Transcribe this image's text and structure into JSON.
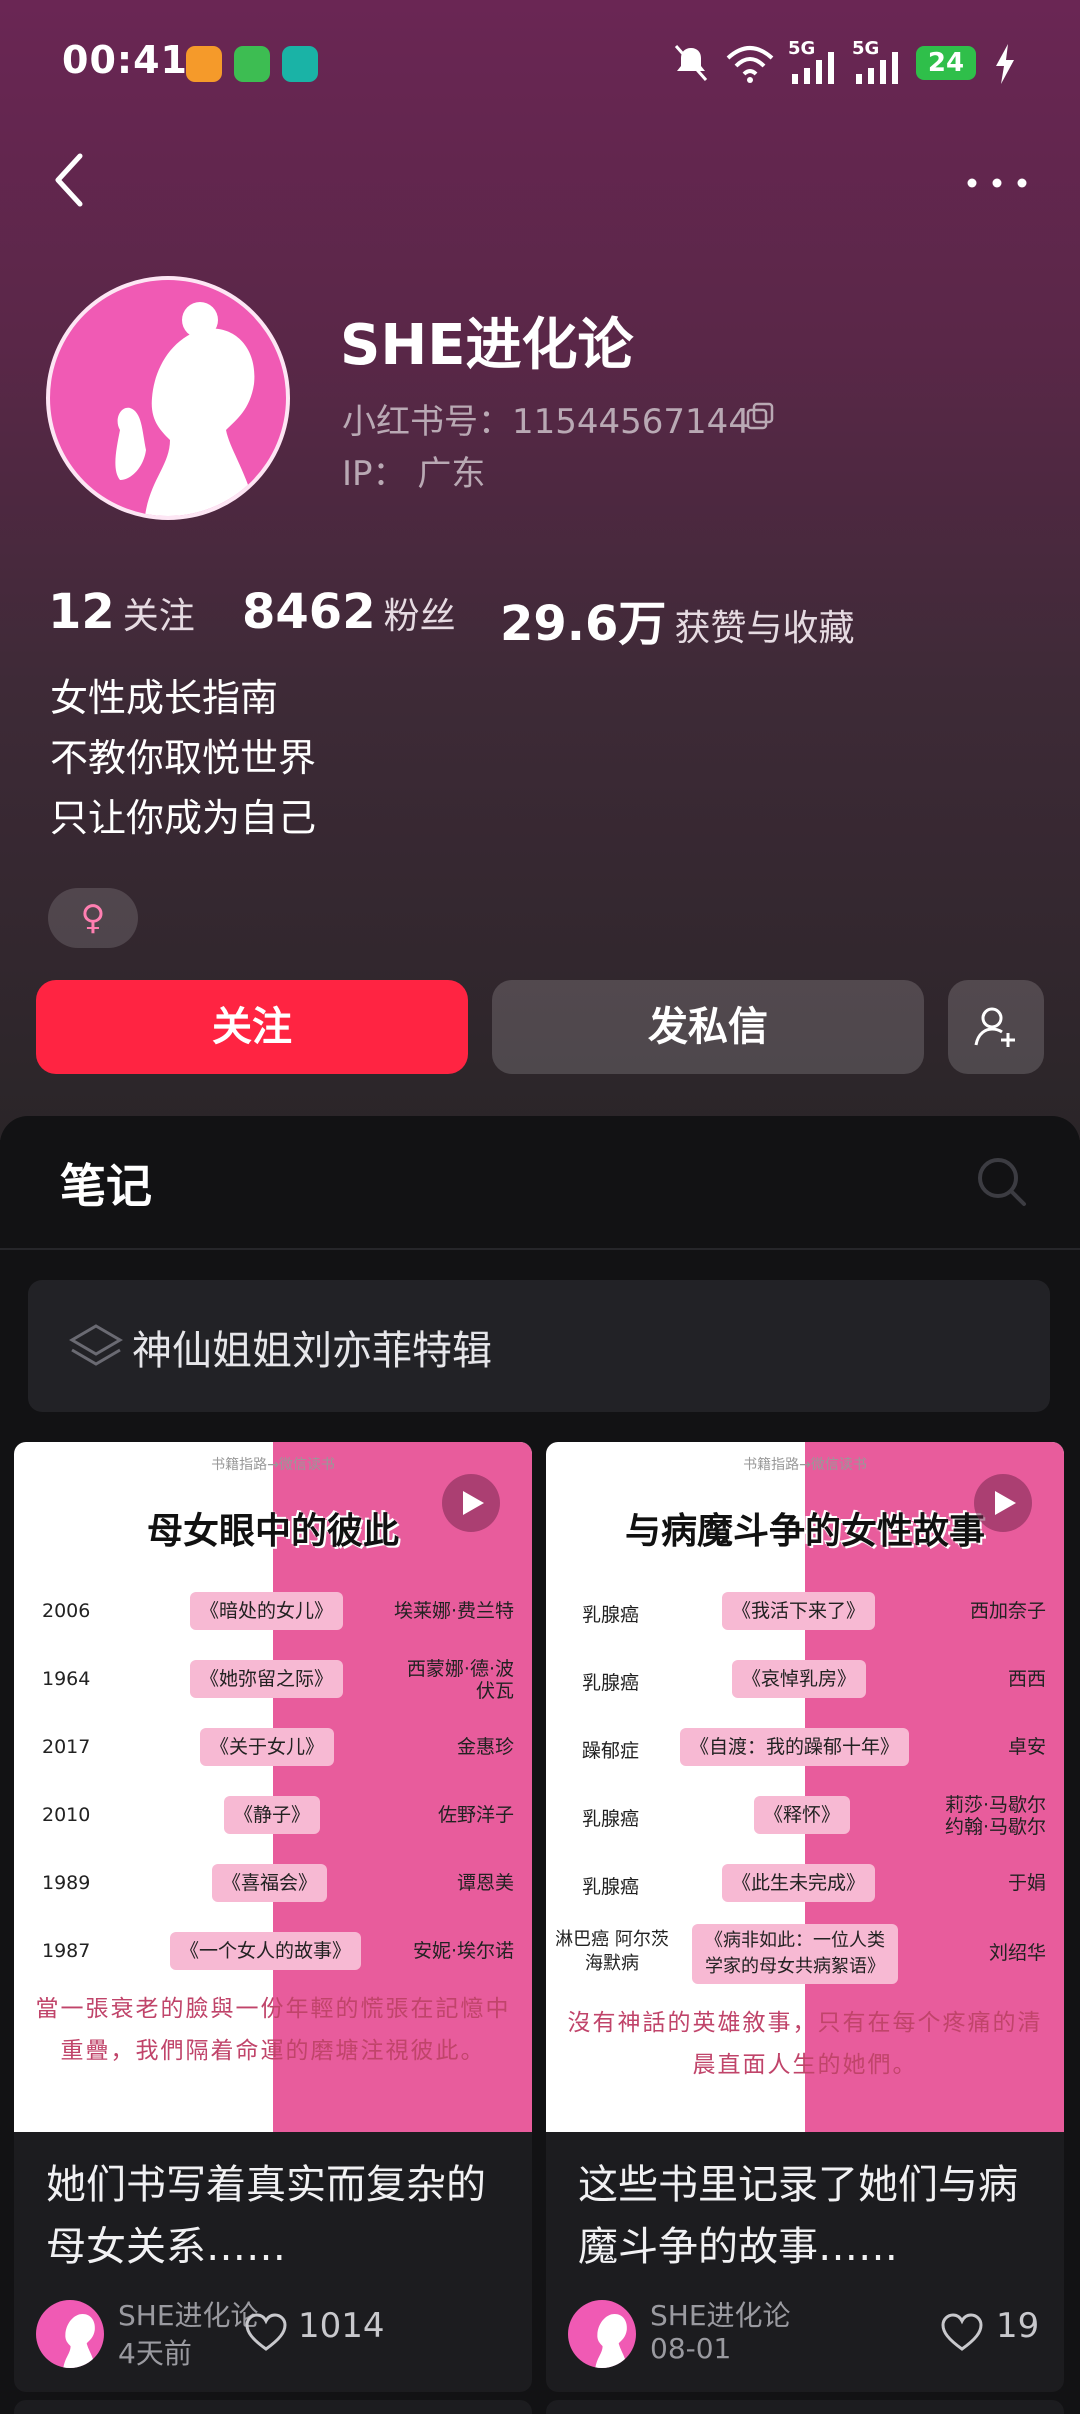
{
  "status_bar": {
    "time": "00:41",
    "battery": "24",
    "network_1": "5G",
    "network_2": "5G",
    "icons": [
      "mute-icon",
      "wifi-icon",
      "signal-icon",
      "charging-icon"
    ]
  },
  "colors": {
    "accent": "#ff2442",
    "avatar_pink": "#f05ab4",
    "hero_top": "#6a2654"
  },
  "profile": {
    "name": "SHE进化论",
    "red_id": "小红书号：11544567144",
    "ip": "IP：  广东",
    "stats": [
      {
        "num": "12",
        "label": "关注"
      },
      {
        "num": "8462",
        "label": "粉丝"
      },
      {
        "num": "29.6万",
        "label": "获赞与收藏"
      }
    ],
    "bio": [
      "女性成长指南",
      "不教你取悦世界",
      "只让你成为自己"
    ],
    "gender_symbol": "♀"
  },
  "actions": {
    "follow": "关注",
    "message": "发私信"
  },
  "notes": {
    "tab_title": "笔记",
    "collection": "神仙姐姐刘亦菲特辑"
  },
  "cards": [
    {
      "cover_small": "书籍指路→微信读书",
      "cover_title": "母女眼中的彼此",
      "rows": [
        {
          "c1": "2006",
          "c2": "《暗处的女儿》",
          "c3": "埃莱娜·费兰特"
        },
        {
          "c1": "1964",
          "c2": "《她弥留之际》",
          "c3": "西蒙娜·德·波伏瓦"
        },
        {
          "c1": "2017",
          "c2": "《关于女儿》",
          "c3": "金惠珍"
        },
        {
          "c1": "2010",
          "c2": "《静子》",
          "c3": "佐野洋子"
        },
        {
          "c1": "1989",
          "c2": "《喜福会》",
          "c3": "谭恩美"
        },
        {
          "c1": "1987",
          "c2": "《一个女人的故事》",
          "c3": "安妮·埃尔诺"
        }
      ],
      "quote": "當一張衰老的臉與一份年輕的慌張在記憶中重疊，我們隔着命運的磨塘注視彼此。",
      "title": "她们书写着真实而复杂的母女关系……",
      "author": "SHE进化论",
      "date": "4天前",
      "likes": "1014"
    },
    {
      "cover_small": "书籍指路→微信读书",
      "cover_title": "与病魔斗争的女性故事",
      "rows": [
        {
          "c1": "乳腺癌",
          "c2": "《我活下来了》",
          "c3": "西加奈子"
        },
        {
          "c1": "乳腺癌",
          "c2": "《哀悼乳房》",
          "c3": "西西"
        },
        {
          "c1": "躁郁症",
          "c2": "《自渡：我的躁郁十年》",
          "c3": "卓安"
        },
        {
          "c1": "乳腺癌",
          "c2": "《释怀》",
          "c3": "莉莎·马歇尔 约翰·马歇尔"
        },
        {
          "c1": "乳腺癌",
          "c2": "《此生未完成》",
          "c3": "于娟"
        },
        {
          "c1": "淋巴癌 阿尔茨海默病",
          "c2": "《病非如此：一位人类学家的母女共病絮语》",
          "c3": "刘绍华"
        }
      ],
      "quote": "沒有神話的英雄敘事，只有在每个疼痛的清晨直面人生的她們。",
      "title": "这些书里记录了她们与病魔斗争的故事……",
      "author": "SHE进化论",
      "date": "08-01",
      "likes": "19"
    }
  ]
}
